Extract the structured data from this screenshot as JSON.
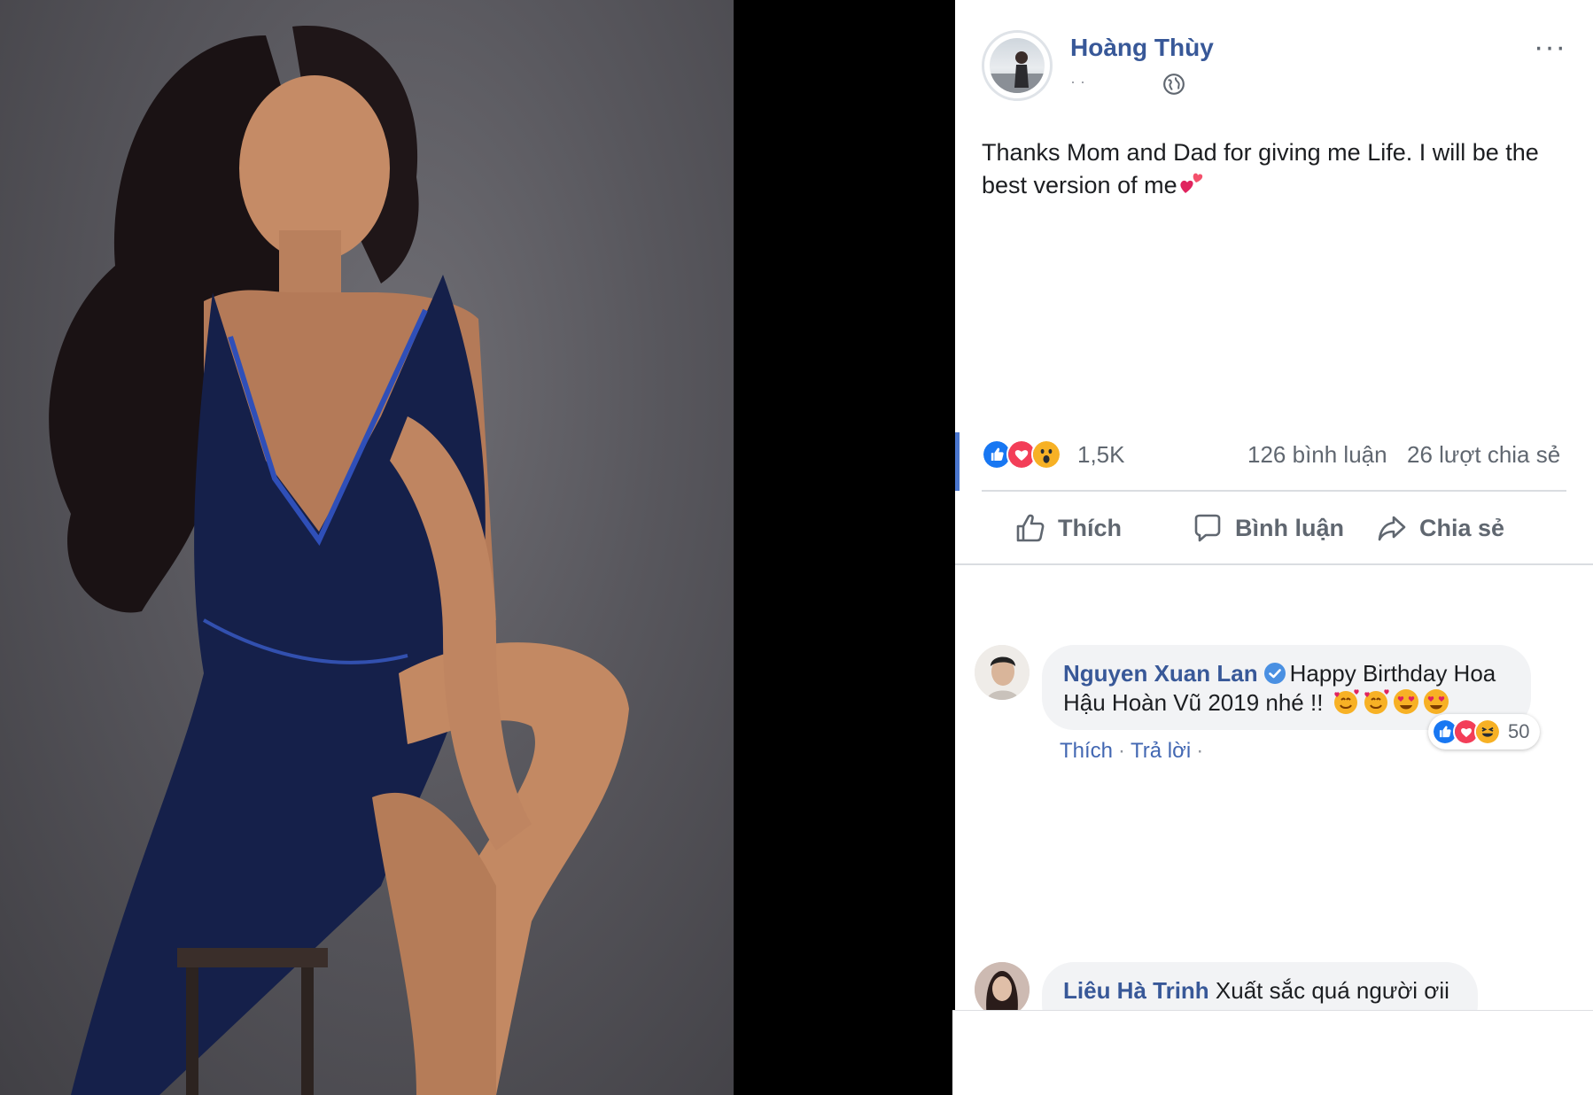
{
  "post": {
    "author": "Hoàng Thùy",
    "meta": "· ·",
    "text_part": "Thanks Mom and Dad for giving me Life. I will be the best version of me",
    "more": "···"
  },
  "stats": {
    "reaction_count": "1,5K",
    "comments": "126 bình luận",
    "shares": "26 lượt chia sẻ"
  },
  "actions": {
    "like": "Thích",
    "comment": "Bình luận",
    "share": "Chia sẻ"
  },
  "comments": [
    {
      "name": "Nguyen Xuan Lan",
      "text": "Happy Birthday Hoa Hậu Hoàn Vũ 2019 nhé !!",
      "like": "Thích",
      "reply": "Trả lời",
      "reaction_count": "50"
    },
    {
      "name": "Liêu Hà Trinh",
      "text": "Xuất sắc quá người ơii"
    }
  ],
  "colors": {
    "link_blue": "#385898",
    "like_blue": "#1877f2",
    "love_red": "#f33e58",
    "wow_yellow": "#f7b125",
    "text_gray": "#606770"
  }
}
